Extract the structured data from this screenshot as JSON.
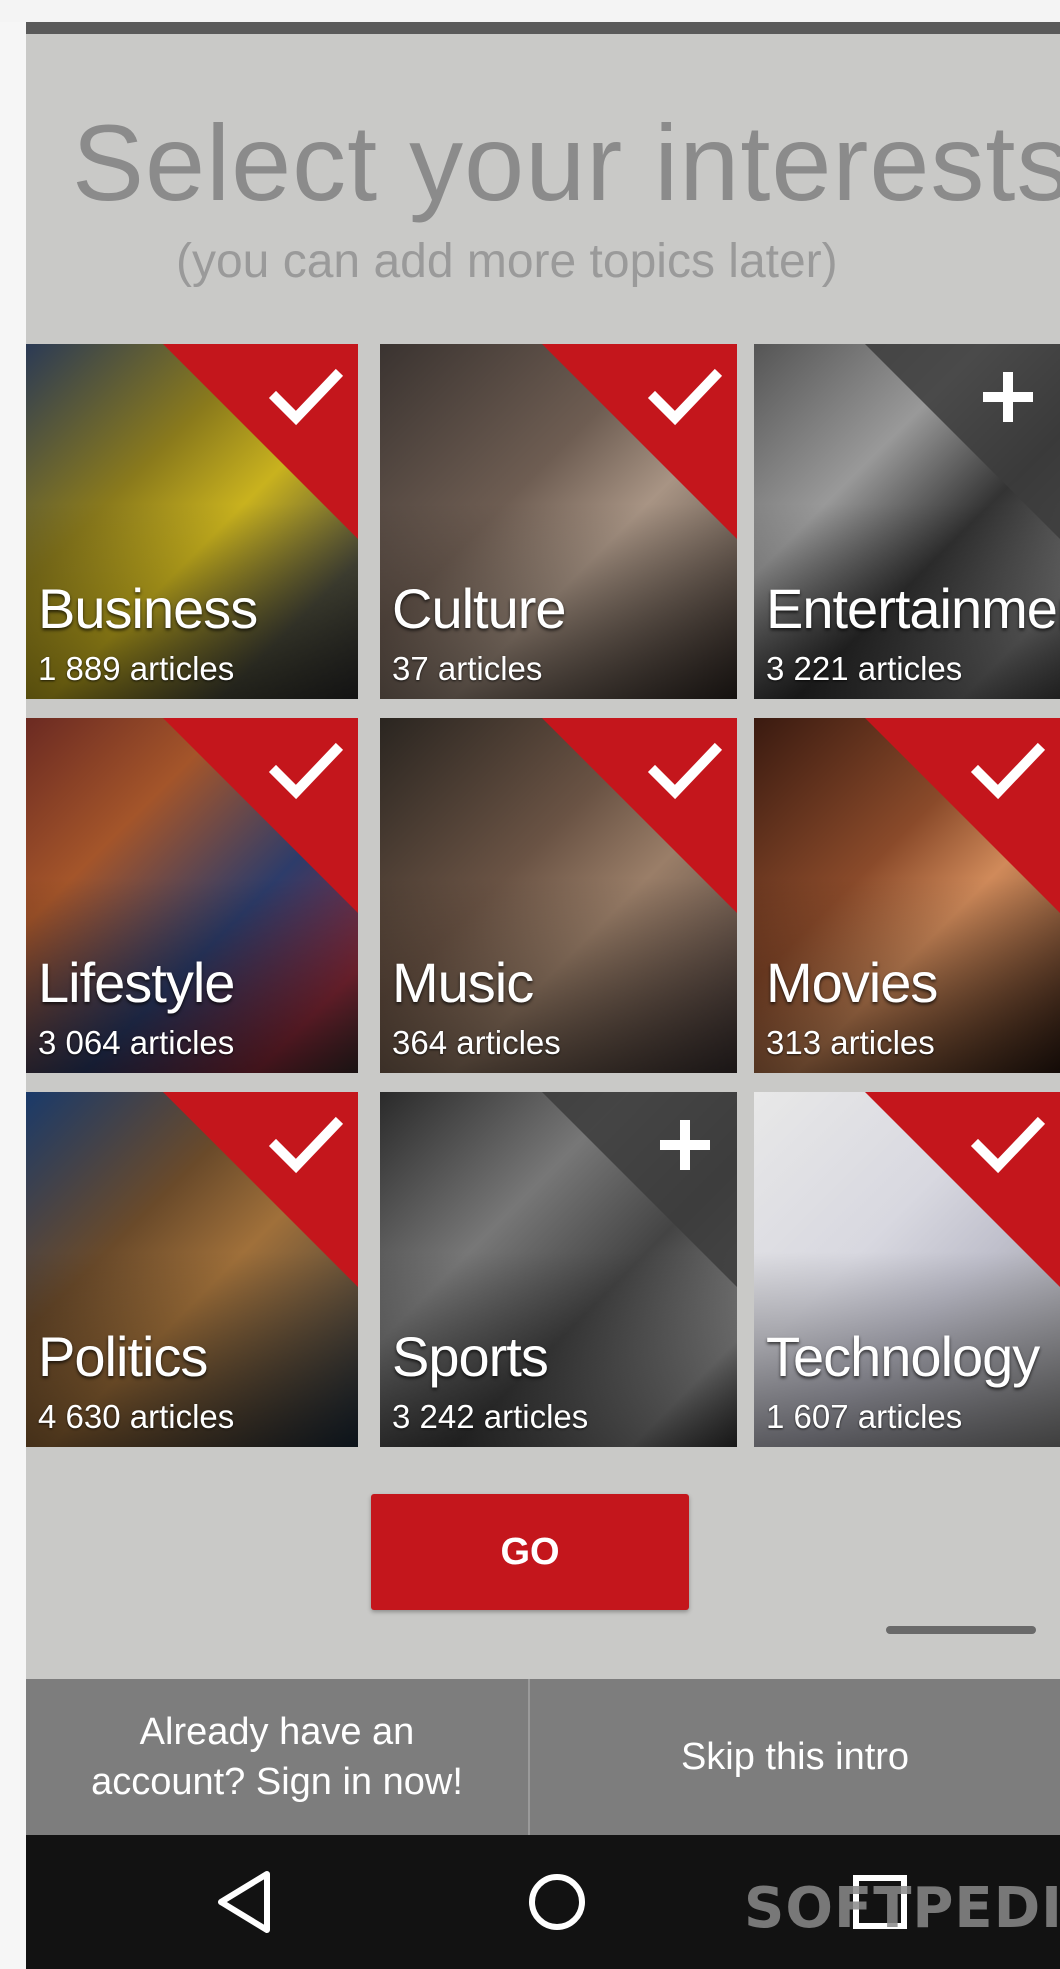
{
  "header": {
    "title": "Select your interests",
    "subtitle": "(you can add more topics later)"
  },
  "topics": [
    {
      "name": "Business",
      "count": "1 889 articles",
      "selected": true,
      "icon": "checkmark-icon"
    },
    {
      "name": "Culture",
      "count": "37 articles",
      "selected": true,
      "icon": "checkmark-icon"
    },
    {
      "name": "Entertainment",
      "count": "3 221 articles",
      "selected": false,
      "icon": "plus-icon"
    },
    {
      "name": "Lifestyle",
      "count": "3 064 articles",
      "selected": true,
      "icon": "checkmark-icon"
    },
    {
      "name": "Music",
      "count": "364 articles",
      "selected": true,
      "icon": "checkmark-icon"
    },
    {
      "name": "Movies",
      "count": "313 articles",
      "selected": true,
      "icon": "checkmark-icon"
    },
    {
      "name": "Politics",
      "count": "4 630 articles",
      "selected": true,
      "icon": "checkmark-icon"
    },
    {
      "name": "Sports",
      "count": "3 242 articles",
      "selected": false,
      "icon": "plus-icon"
    },
    {
      "name": "Technology",
      "count": "1 607 articles",
      "selected": true,
      "icon": "checkmark-icon"
    }
  ],
  "actions": {
    "go_label": "GO",
    "signin_label": "Already have an account? Sign in now!",
    "skip_label": "Skip this intro"
  },
  "navbar": {
    "back_icon": "back-triangle-icon",
    "home_icon": "home-circle-icon",
    "recents_icon": "recents-square-icon"
  },
  "watermark": "SOFTPEDIA",
  "colors": {
    "accent": "#c4161c",
    "background": "#c9c9c7",
    "bottom_bar": "#7d7d7d",
    "navbar": "#121212"
  }
}
